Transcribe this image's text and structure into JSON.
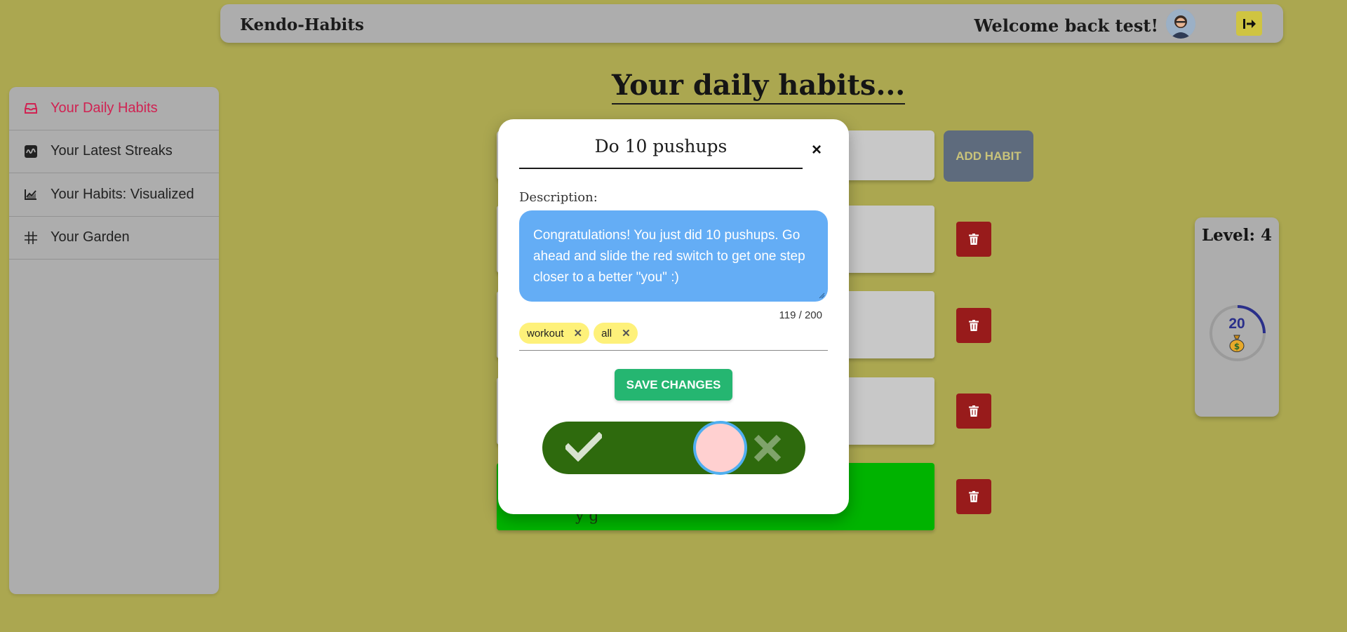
{
  "header": {
    "brand": "Kendo-Habits",
    "welcome": "Welcome back test!",
    "logout_icon": "logout-icon",
    "avatar_icon": "user-avatar"
  },
  "sidebar": {
    "items": [
      {
        "label": "Your Daily Habits",
        "icon": "inbox-icon",
        "active": true
      },
      {
        "label": "Your Latest Streaks",
        "icon": "streak-icon",
        "active": false
      },
      {
        "label": "Your Habits: Visualized",
        "icon": "chart-icon",
        "active": false
      },
      {
        "label": "Your Garden",
        "icon": "grid-icon",
        "active": false
      }
    ]
  },
  "main": {
    "title": "Your daily habits...",
    "add_button": "ADD HABIT",
    "habits": [
      {
        "status": "pending"
      },
      {
        "status": "pending"
      },
      {
        "status": "pending"
      },
      {
        "status": "done"
      }
    ],
    "visible_done_text": "y                    g"
  },
  "level_card": {
    "level": "Level: 4",
    "coins": "20",
    "coin_icon": "money-bag-icon"
  },
  "modal": {
    "title": "Do 10 pushups",
    "close": "×",
    "description_label": "Description:",
    "description": "Congratulations! You just did 10 pushups. Go ahead and slide the red switch to get one step closer to a better \"you\" :)",
    "char_count": "119 / 200",
    "tags": [
      "workout",
      "all"
    ],
    "save_button": "SAVE CHANGES",
    "toggle": {
      "state": "incomplete",
      "check_icon": "check-icon",
      "cross_icon": "cross-icon"
    }
  },
  "colors": {
    "background": "#aba750",
    "active_link": "#d02252",
    "save": "#25b671",
    "toggle": "#2e6a0d",
    "description_bg": "#64adf5",
    "tag": "#fef17a",
    "delete": "#981b1b",
    "done": "#00b300"
  }
}
